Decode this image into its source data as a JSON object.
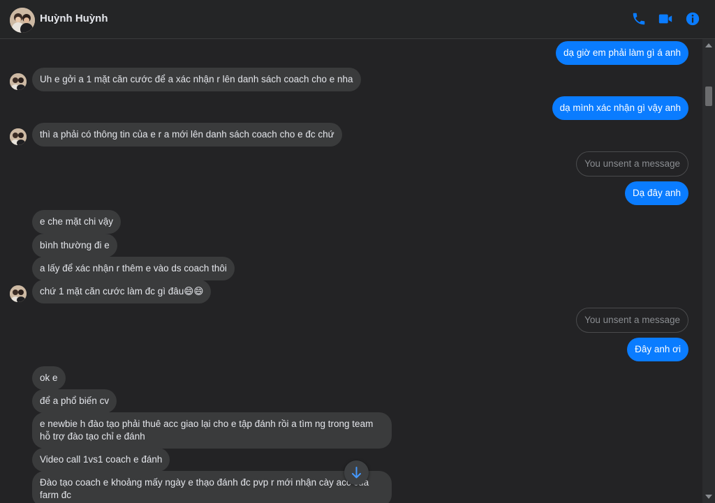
{
  "header": {
    "title": "Huỳnh Huỳnh",
    "icons": [
      "phone-icon",
      "video-camera-icon",
      "info-icon"
    ],
    "accent": "#0a7cff"
  },
  "messages": {
    "m1": "dạ giờ em phải làm gì á anh",
    "m2": "Uh e gởi a 1 mặt căn cước để a xác nhận r lên danh sách coach cho e nha",
    "m3": "dạ mình xác nhận gì vậy anh",
    "m4": "thì a phải có thông tin của e r a mới lên danh sách coach cho e đc chứ",
    "m5": "You unsent a message",
    "m6": "Dạ đây anh",
    "m7": "e che mặt chi vậy",
    "m8": "bình thường đi e",
    "m9": "a lấy để xác nhận r thêm e vào ds coach thôi",
    "m10": "chứ 1 mặt căn cước làm đc gì đâu😄😄",
    "m11": "You unsent a message",
    "m12": "Đây anh ơi",
    "m13": "ok e",
    "m14": "để a phổ biến cv",
    "m15": "e newbie h đào tạo phải thuê acc giao lại cho e tập đánh rồi a tìm ng trong team hỗ trợ đào tạo chỉ e đánh",
    "m16": "Video call 1vs1 coach e đánh",
    "m17": "Đào tạo coach e khoảng mấy ngày e thạo đánh đc pvp r mới nhận cày acc của farm đc"
  },
  "colors": {
    "background": "#232325",
    "incoming_bubble": "#3a3b3c",
    "outgoing_bubble": "#0a7cff"
  }
}
